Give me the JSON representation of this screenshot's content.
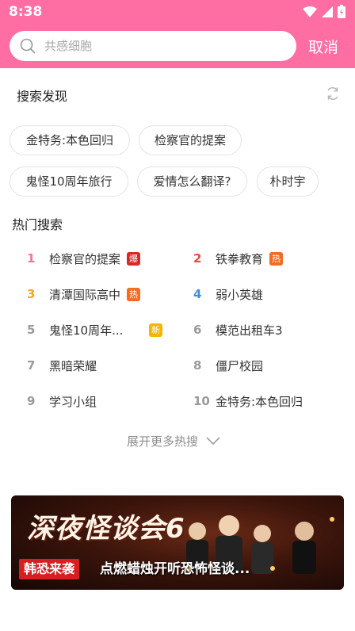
{
  "status_bar": {
    "time": "8:38"
  },
  "search": {
    "placeholder": "共感细胞",
    "value": "",
    "cancel_label": "取消"
  },
  "discover": {
    "title": "搜索发现",
    "chips": [
      "金特务:本色回归",
      "检察官的提案",
      "鬼怪10周年旅行",
      "爱情怎么翻译?",
      "朴时宇"
    ]
  },
  "hot_search": {
    "title": "热门搜索",
    "items": [
      {
        "rank": "1",
        "title": "检察官的提案",
        "tag": "爆",
        "rank_color": "#ff6ea3",
        "tag_color": "#d32a2a"
      },
      {
        "rank": "2",
        "title": "铁拳教育",
        "tag": "热",
        "rank_color": "#f04646",
        "tag_color": "#f36c21"
      },
      {
        "rank": "3",
        "title": "清潭国际高中",
        "tag": "热",
        "rank_color": "#f5a623",
        "tag_color": "#f36c21"
      },
      {
        "rank": "4",
        "title": "弱小英雄",
        "tag": "",
        "rank_color": "#3c8ee6",
        "tag_color": ""
      },
      {
        "rank": "5",
        "title": "鬼怪10周年...",
        "tag": "新",
        "rank_color": "#9a9a9a",
        "tag_color": "#f7b500"
      },
      {
        "rank": "6",
        "title": "模范出租车3",
        "tag": "",
        "rank_color": "#9a9a9a",
        "tag_color": ""
      },
      {
        "rank": "7",
        "title": "黑暗荣耀",
        "tag": "",
        "rank_color": "#9a9a9a",
        "tag_color": ""
      },
      {
        "rank": "8",
        "title": "僵尸校园",
        "tag": "",
        "rank_color": "#9a9a9a",
        "tag_color": ""
      },
      {
        "rank": "9",
        "title": "学习小组",
        "tag": "",
        "rank_color": "#9a9a9a",
        "tag_color": ""
      },
      {
        "rank": "10",
        "title": "金特务:本色回归",
        "tag": "",
        "rank_color": "#9a9a9a",
        "tag_color": ""
      }
    ],
    "expand_label": "展开更多热搜"
  },
  "banner": {
    "title": "深夜怪谈会6",
    "tag": "韩恐来袭",
    "subtitle": "点燃蜡烛开听恐怖怪谈..."
  },
  "colors": {
    "brand": "#ff6ea3"
  },
  "icons": [
    "wifi-icon",
    "signal-icon",
    "battery-icon",
    "search-icon",
    "refresh-icon",
    "chevron-down-icon"
  ]
}
